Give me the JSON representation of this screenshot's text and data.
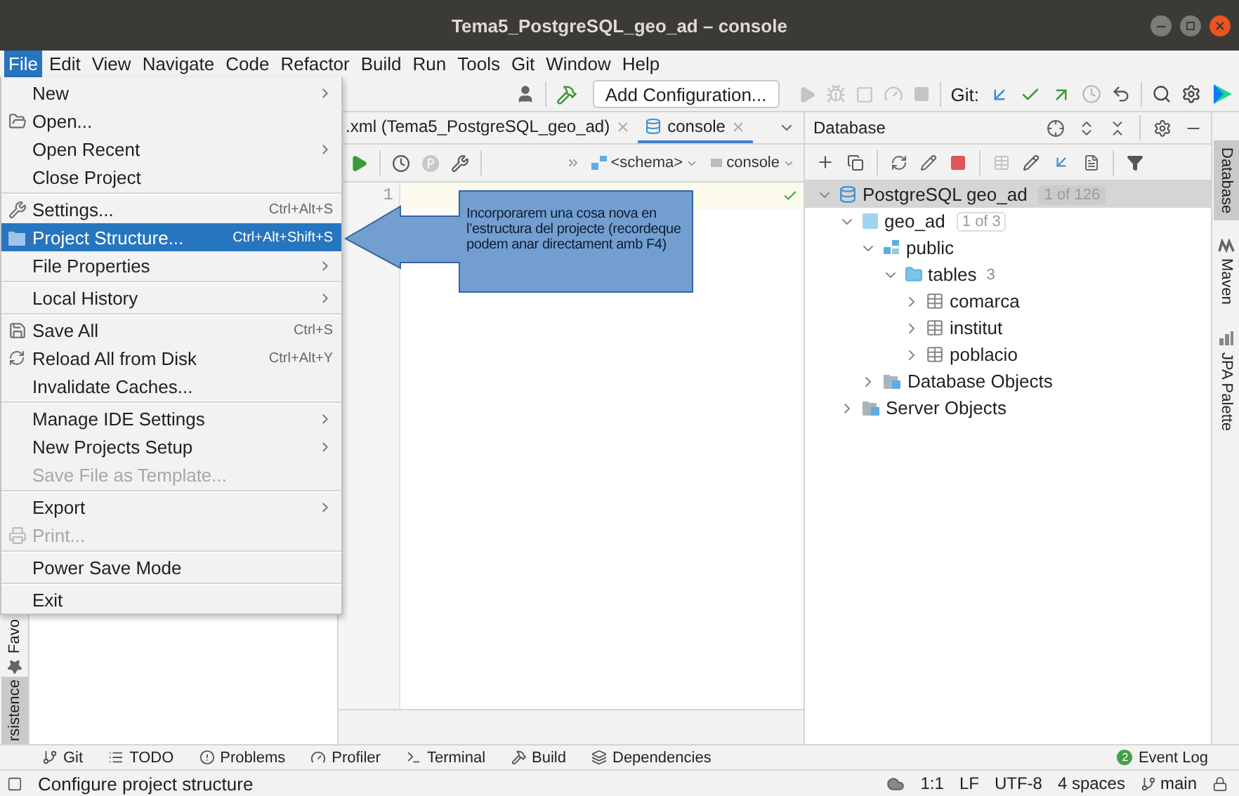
{
  "window": {
    "title": "Tema5_PostgreSQL_geo_ad – console"
  },
  "menu_bar": [
    {
      "label": "File",
      "selected": true
    },
    {
      "label": "Edit",
      "selected": false
    },
    {
      "label": "View",
      "selected": false
    },
    {
      "label": "Navigate",
      "selected": false
    },
    {
      "label": "Code",
      "selected": false
    },
    {
      "label": "Refactor",
      "selected": false
    },
    {
      "label": "Build",
      "selected": false
    },
    {
      "label": "Run",
      "selected": false
    },
    {
      "label": "Tools",
      "selected": false
    },
    {
      "label": "Git",
      "selected": false
    },
    {
      "label": "Window",
      "selected": false
    },
    {
      "label": "Help",
      "selected": false
    }
  ],
  "file_menu": [
    {
      "kind": "item",
      "label": "New",
      "submenu": true,
      "disabled": false,
      "selected": false
    },
    {
      "kind": "item",
      "label": "Open...",
      "submenu": false,
      "disabled": false,
      "selected": false
    },
    {
      "kind": "item",
      "label": "Open Recent",
      "submenu": true,
      "disabled": false,
      "selected": false
    },
    {
      "kind": "item",
      "label": "Close Project",
      "submenu": false,
      "disabled": false,
      "selected": false
    },
    {
      "kind": "separator"
    },
    {
      "kind": "item",
      "label": "Settings...",
      "shortcut": "Ctrl+Alt+S",
      "submenu": false,
      "disabled": false,
      "selected": false
    },
    {
      "kind": "item",
      "label": "Project Structure...",
      "shortcut": "Ctrl+Alt+Shift+S",
      "submenu": false,
      "disabled": false,
      "selected": true
    },
    {
      "kind": "item",
      "label": "File Properties",
      "submenu": true,
      "disabled": false,
      "selected": false
    },
    {
      "kind": "separator"
    },
    {
      "kind": "item",
      "label": "Local History",
      "submenu": true,
      "disabled": false,
      "selected": false
    },
    {
      "kind": "separator"
    },
    {
      "kind": "item",
      "label": "Save All",
      "shortcut": "Ctrl+S",
      "submenu": false,
      "disabled": false,
      "selected": false
    },
    {
      "kind": "item",
      "label": "Reload All from Disk",
      "shortcut": "Ctrl+Alt+Y",
      "submenu": false,
      "disabled": false,
      "selected": false
    },
    {
      "kind": "item",
      "label": "Invalidate Caches...",
      "submenu": false,
      "disabled": false,
      "selected": false
    },
    {
      "kind": "separator"
    },
    {
      "kind": "item",
      "label": "Manage IDE Settings",
      "submenu": true,
      "disabled": false,
      "selected": false
    },
    {
      "kind": "item",
      "label": "New Projects Setup",
      "submenu": true,
      "disabled": false,
      "selected": false
    },
    {
      "kind": "item",
      "label": "Save File as Template...",
      "submenu": false,
      "disabled": true,
      "selected": false
    },
    {
      "kind": "separator"
    },
    {
      "kind": "item",
      "label": "Export",
      "submenu": true,
      "disabled": false,
      "selected": false
    },
    {
      "kind": "item",
      "label": "Print...",
      "submenu": false,
      "disabled": true,
      "selected": false
    },
    {
      "kind": "separator"
    },
    {
      "kind": "item",
      "label": "Power Save Mode",
      "submenu": false,
      "disabled": false,
      "selected": false
    },
    {
      "kind": "separator"
    },
    {
      "kind": "item",
      "label": "Exit",
      "submenu": false,
      "disabled": false,
      "selected": false
    }
  ],
  "toolbar": {
    "run_config": "Add Configuration...",
    "git_label": "Git:"
  },
  "editor": {
    "tabs": [
      {
        "label": ".xml (Tema5_PostgreSQL_geo_ad)",
        "selected": false
      },
      {
        "label": "console",
        "selected": true
      }
    ],
    "schema": "<schema>",
    "session": "console",
    "line_numbers": [
      "1"
    ]
  },
  "callout": {
    "text": "Incorporarem una cosa nova en l’estructura del projecte (recordeque podem anar directament amb F4)"
  },
  "database": {
    "title": "Database",
    "tree": [
      {
        "kind": "datasource",
        "label": "PostgreSQL geo_ad",
        "badge": "1 of 126",
        "expanded": true,
        "selected": true,
        "children": [
          {
            "kind": "database",
            "label": "geo_ad",
            "badge": "1 of 3",
            "expanded": true,
            "selected": false,
            "children": [
              {
                "kind": "schema",
                "label": "public",
                "expanded": true,
                "selected": false,
                "children": [
                  {
                    "kind": "folder",
                    "label": "tables",
                    "count": "3",
                    "expanded": true,
                    "selected": false,
                    "children": [
                      {
                        "kind": "table",
                        "label": "comarca",
                        "expanded": false,
                        "selected": false
                      },
                      {
                        "kind": "table",
                        "label": "institut",
                        "expanded": false,
                        "selected": false
                      },
                      {
                        "kind": "table",
                        "label": "poblacio",
                        "expanded": false,
                        "selected": false
                      }
                    ]
                  }
                ]
              },
              {
                "kind": "objects",
                "label": "Database Objects",
                "expanded": false,
                "selected": false
              }
            ]
          },
          {
            "kind": "objects",
            "label": "Server Objects",
            "expanded": false,
            "selected": false
          }
        ]
      }
    ]
  },
  "left_stripe": [
    {
      "label": "Favo",
      "selected": false
    },
    {
      "label": "rsistence",
      "selected": true
    }
  ],
  "right_stripe": [
    {
      "label": "Database",
      "selected": true
    },
    {
      "label": "Maven",
      "selected": false
    },
    {
      "label": "JPA Palette",
      "selected": false
    }
  ],
  "tool_windows": [
    {
      "label": "Git"
    },
    {
      "label": "TODO"
    },
    {
      "label": "Problems"
    },
    {
      "label": "Profiler"
    },
    {
      "label": "Terminal"
    },
    {
      "label": "Build"
    },
    {
      "label": "Dependencies"
    }
  ],
  "event_log": {
    "label": "Event Log",
    "count": "2"
  },
  "status_bar": {
    "message": "Configure project structure",
    "position": "1:1",
    "line_separator": "LF",
    "encoding": "UTF-8",
    "indent": "4 spaces",
    "branch": "main"
  }
}
